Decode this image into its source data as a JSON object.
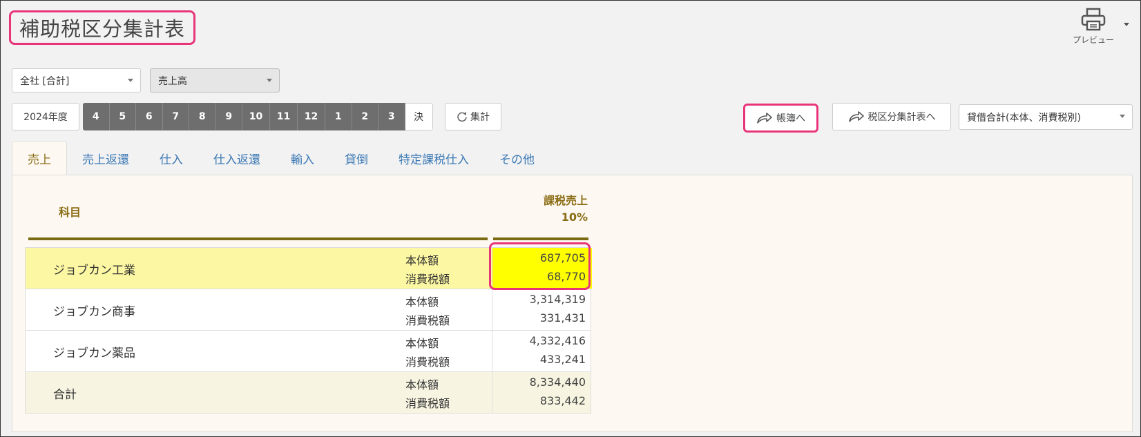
{
  "header": {
    "title": "補助税区分集計表",
    "preview_label": "プレビュー"
  },
  "filters": {
    "company": "全社 [合計]",
    "account_type": "売上高"
  },
  "period": {
    "year": "2024年度",
    "months": [
      "4",
      "5",
      "6",
      "7",
      "8",
      "9",
      "10",
      "11",
      "12",
      "1",
      "2",
      "3"
    ],
    "settlement": "決",
    "aggregate": "集計"
  },
  "actions": {
    "to_ledger": "帳簿へ",
    "to_tax_summary": "税区分集計表へ",
    "display_mode": "貸借合計(本体、消費税別)"
  },
  "tabs": [
    {
      "label": "売上",
      "active": true
    },
    {
      "label": "売上返還",
      "active": false
    },
    {
      "label": "仕入",
      "active": false
    },
    {
      "label": "仕入返還",
      "active": false
    },
    {
      "label": "輸入",
      "active": false
    },
    {
      "label": "貸倒",
      "active": false
    },
    {
      "label": "特定課税仕入",
      "active": false
    },
    {
      "label": "その他",
      "active": false
    }
  ],
  "table": {
    "col_subject": "科目",
    "col_value_line1": "課税売上",
    "col_value_line2": "10%",
    "kind_base": "本体額",
    "kind_tax": "消費税額",
    "rows": [
      {
        "name": "ジョブカン工業",
        "base": "687,705",
        "tax": "68,770"
      },
      {
        "name": "ジョブカン商事",
        "base": "3,314,319",
        "tax": "331,431"
      },
      {
        "name": "ジョブカン薬品",
        "base": "4,332,416",
        "tax": "433,241"
      },
      {
        "name": "合計",
        "base": "8,334,440",
        "tax": "833,442"
      }
    ]
  },
  "colors": {
    "highlight": "#e8357a",
    "selected_row": "#fcf7a2",
    "selected_cell": "#ffff00",
    "header_text": "#8a6d15"
  }
}
